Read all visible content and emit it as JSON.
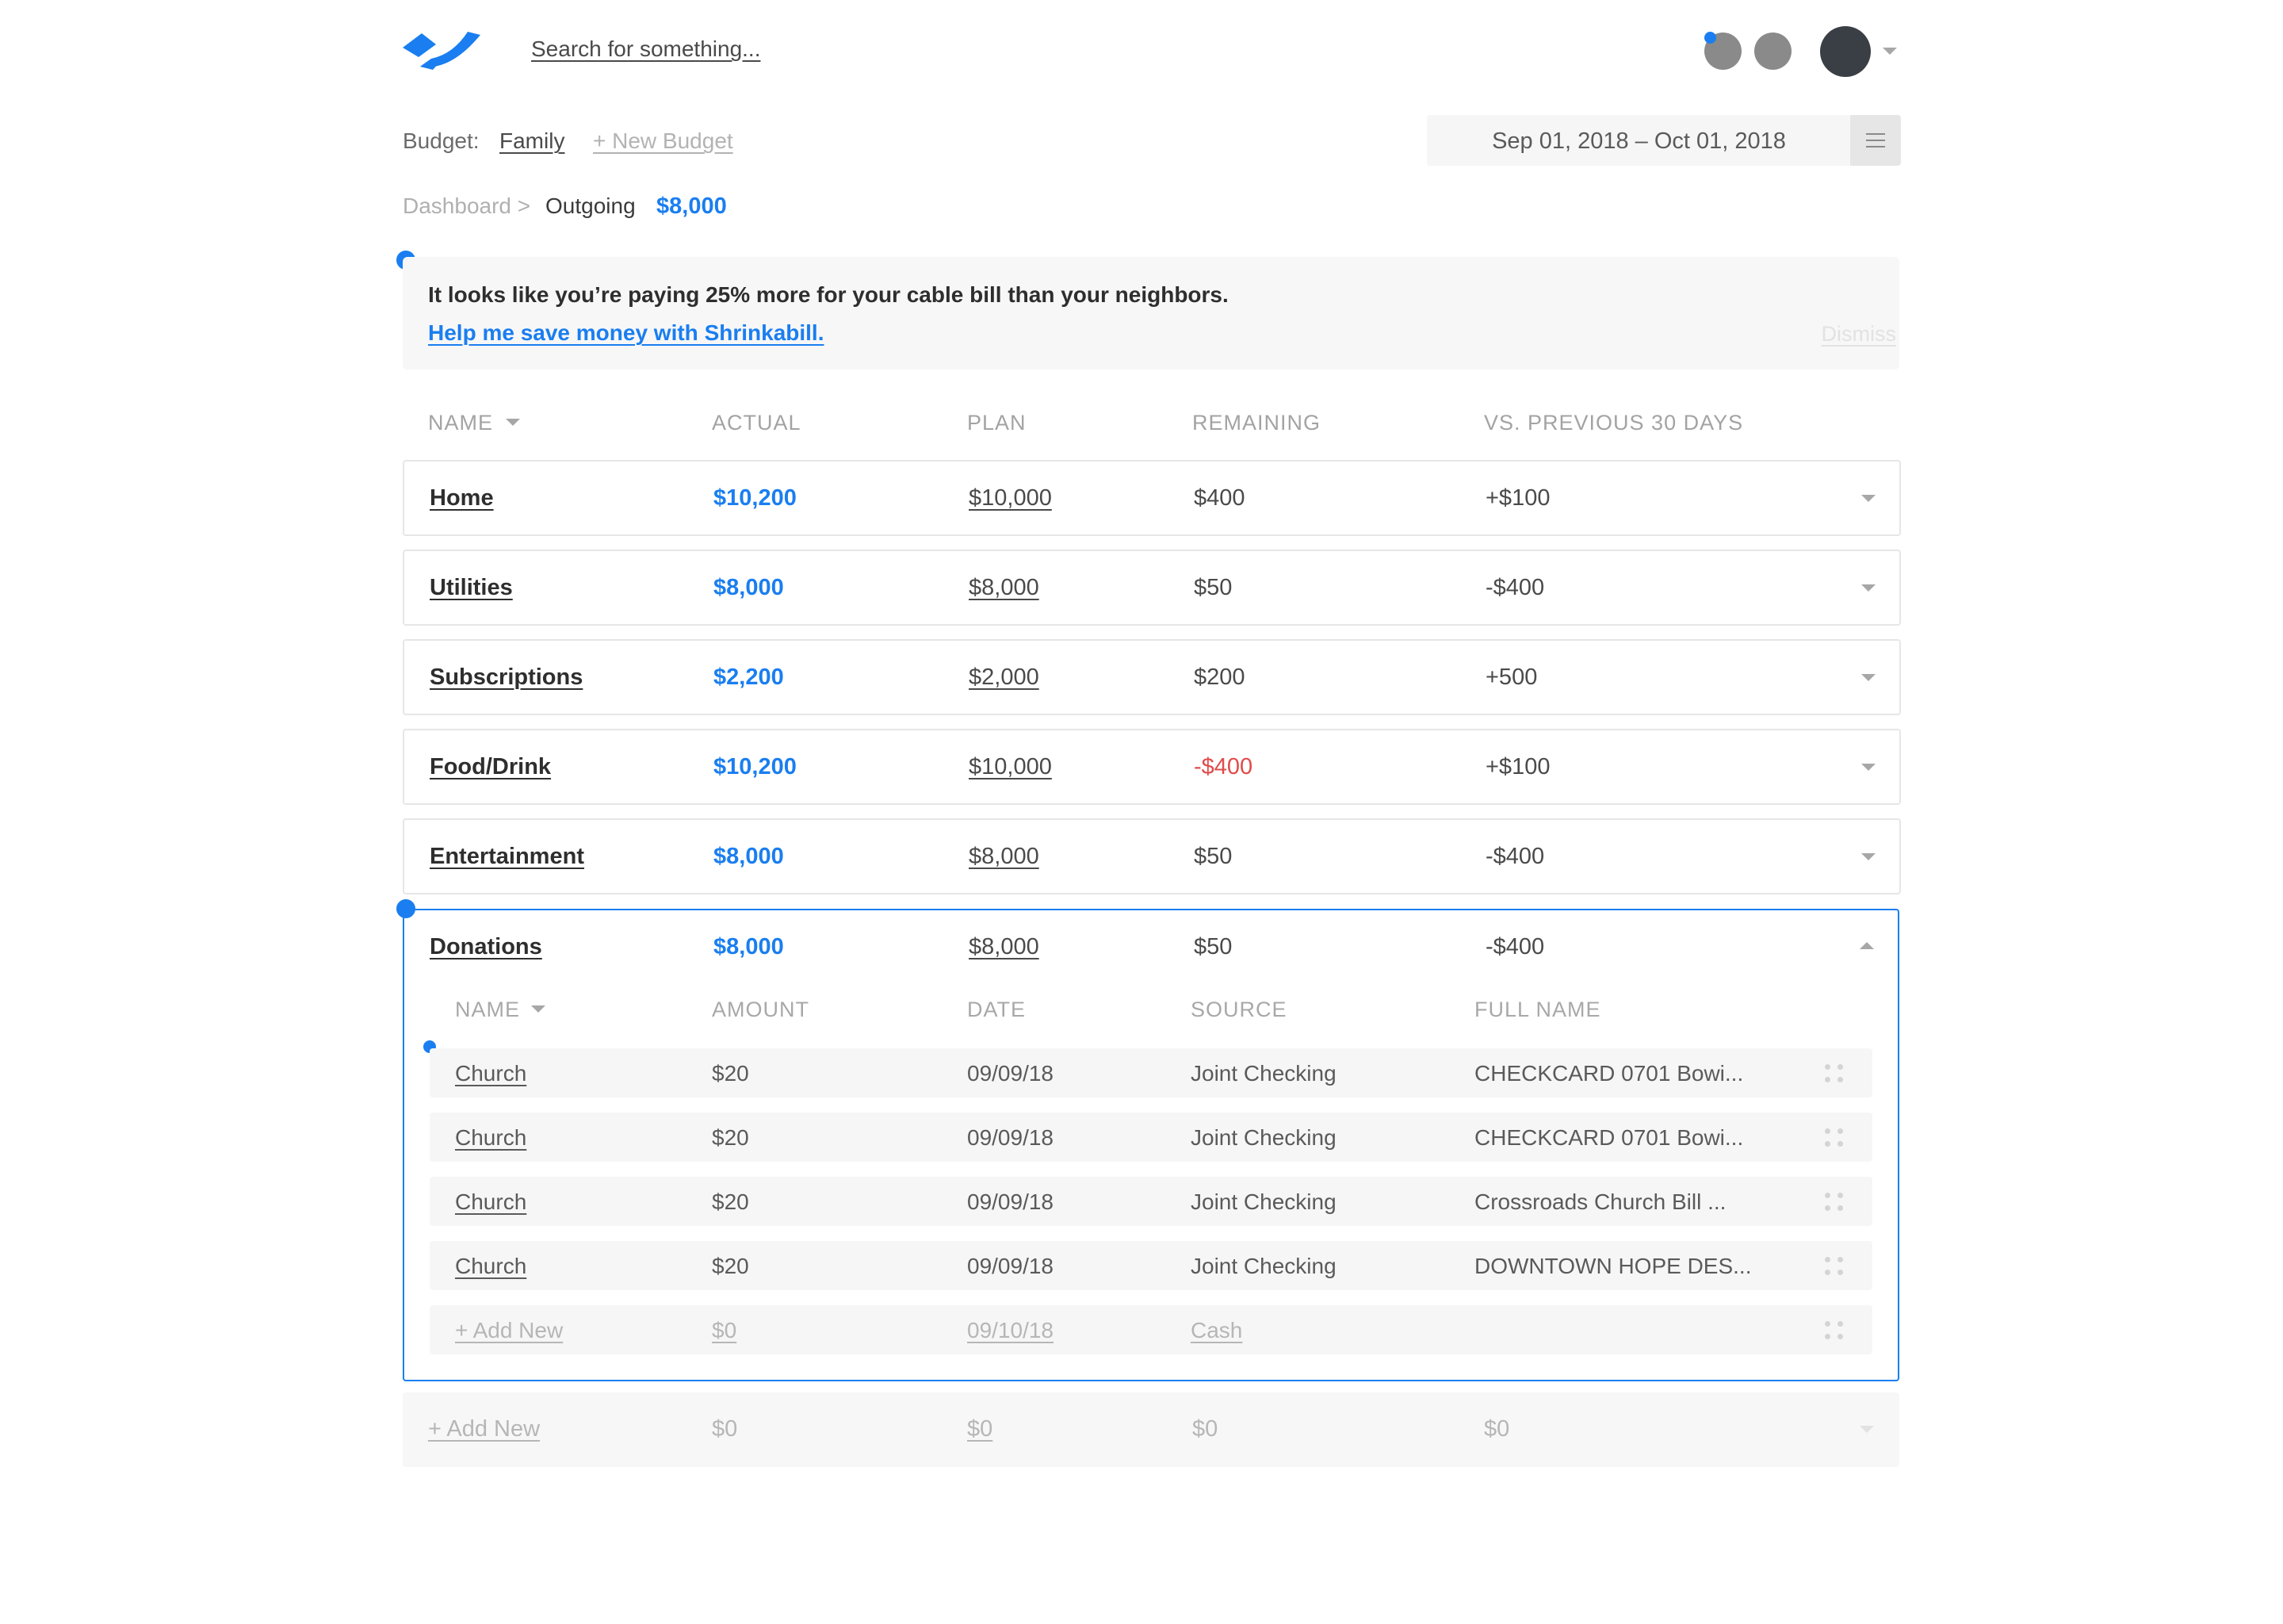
{
  "header": {
    "search_placeholder": "Search for something...",
    "icons": [
      "logo-icon",
      "notification-avatar",
      "user-avatar",
      "chevron-down-icon"
    ]
  },
  "budget": {
    "label": "Budget:",
    "name": "Family",
    "new_budget": "+ New Budget",
    "date_range": "Sep 01, 2018 – Oct 01, 2018"
  },
  "breadcrumb": {
    "dashboard": "Dashboard",
    "separator": ">",
    "current": "Outgoing",
    "amount": "$8,000"
  },
  "alert": {
    "message": "It looks like you’re paying 25% more for your cable bill than your neighbors.",
    "link": "Help me save money with Shrinkabill.",
    "dismiss": "Dismiss"
  },
  "table": {
    "headers": [
      "NAME",
      "ACTUAL",
      "PLAN",
      "REMAINING",
      "VS. PREVIOUS 30 DAYS"
    ],
    "rows": [
      {
        "name": "Home",
        "actual": "$10,200",
        "plan": "$10,000",
        "remaining": "$400",
        "vs": "+$100"
      },
      {
        "name": "Utilities",
        "actual": "$8,000",
        "plan": "$8,000",
        "remaining": "$50",
        "vs": "-$400"
      },
      {
        "name": "Subscriptions",
        "actual": "$2,200",
        "plan": "$2,000",
        "remaining": "$200",
        "vs": "+500"
      },
      {
        "name": "Food/Drink",
        "actual": "$10,200",
        "plan": "$10,000",
        "remaining": "-$400",
        "vs": "+$100"
      },
      {
        "name": "Entertainment",
        "actual": "$8,000",
        "plan": "$8,000",
        "remaining": "$50",
        "vs": "-$400"
      }
    ],
    "expanded": {
      "name": "Donations",
      "actual": "$8,000",
      "plan": "$8,000",
      "remaining": "$50",
      "vs": "-$400",
      "sub_headers": [
        "NAME",
        "AMOUNT",
        "DATE",
        "SOURCE",
        "FULL NAME"
      ],
      "transactions": [
        {
          "name": "Church",
          "amount": "$20",
          "date": "09/09/18",
          "source": "Joint Checking",
          "full_name": "CHECKCARD 0701 Bowi..."
        },
        {
          "name": "Church",
          "amount": "$20",
          "date": "09/09/18",
          "source": "Joint Checking",
          "full_name": "CHECKCARD 0701 Bowi..."
        },
        {
          "name": "Church",
          "amount": "$20",
          "date": "09/09/18",
          "source": "Joint Checking",
          "full_name": "Crossroads Church Bill ..."
        },
        {
          "name": "Church",
          "amount": "$20",
          "date": "09/09/18",
          "source": "Joint Checking",
          "full_name": "DOWNTOWN HOPE DES..."
        }
      ],
      "add_new": {
        "name": "+ Add New",
        "amount": "$0",
        "date": "09/10/18",
        "source": "Cash"
      }
    },
    "add_row": {
      "name": "+ Add New",
      "actual": "$0",
      "plan": "$0",
      "remaining": "$0",
      "vs": "$0"
    }
  },
  "colors": {
    "accent": "#1a7ef0",
    "negative": "#e04b4b",
    "border": "#e6e6e6",
    "muted": "#f7f7f7"
  }
}
